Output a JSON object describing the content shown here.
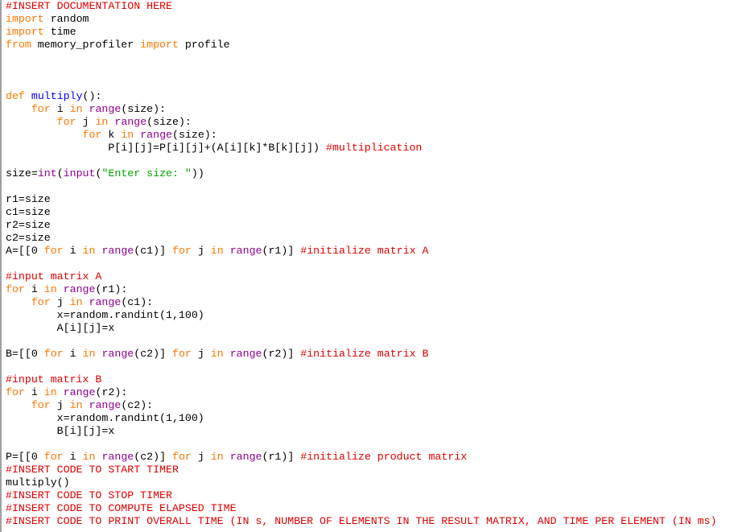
{
  "editor": {
    "colors": {
      "keyword": "#ff7700",
      "builtin": "#900090",
      "comment": "#dd0000",
      "string": "#00aa00",
      "definition": "#0000ff",
      "default": "#000000"
    },
    "lines": [
      [
        {
          "t": "cm",
          "v": "#INSERT DOCUMENTATION HERE"
        }
      ],
      [
        {
          "t": "kw",
          "v": "import"
        },
        {
          "t": "df",
          "v": " random"
        }
      ],
      [
        {
          "t": "kw",
          "v": "import"
        },
        {
          "t": "df",
          "v": " time"
        }
      ],
      [
        {
          "t": "kw",
          "v": "from"
        },
        {
          "t": "df",
          "v": " memory_profiler "
        },
        {
          "t": "kw",
          "v": "import"
        },
        {
          "t": "df",
          "v": " profile"
        }
      ],
      [],
      [],
      [],
      [
        {
          "t": "kw",
          "v": "def"
        },
        {
          "t": "df",
          "v": " "
        },
        {
          "t": "fn",
          "v": "multiply"
        },
        {
          "t": "df",
          "v": "():"
        }
      ],
      [
        {
          "t": "df",
          "v": "    "
        },
        {
          "t": "kw",
          "v": "for"
        },
        {
          "t": "df",
          "v": " i "
        },
        {
          "t": "kw",
          "v": "in"
        },
        {
          "t": "df",
          "v": " "
        },
        {
          "t": "bi",
          "v": "range"
        },
        {
          "t": "df",
          "v": "(size):"
        }
      ],
      [
        {
          "t": "df",
          "v": "        "
        },
        {
          "t": "kw",
          "v": "for"
        },
        {
          "t": "df",
          "v": " j "
        },
        {
          "t": "kw",
          "v": "in"
        },
        {
          "t": "df",
          "v": " "
        },
        {
          "t": "bi",
          "v": "range"
        },
        {
          "t": "df",
          "v": "(size):"
        }
      ],
      [
        {
          "t": "df",
          "v": "            "
        },
        {
          "t": "kw",
          "v": "for"
        },
        {
          "t": "df",
          "v": " k "
        },
        {
          "t": "kw",
          "v": "in"
        },
        {
          "t": "df",
          "v": " "
        },
        {
          "t": "bi",
          "v": "range"
        },
        {
          "t": "df",
          "v": "(size):"
        }
      ],
      [
        {
          "t": "df",
          "v": "                P[i][j]=P[i][j]+(A[i][k]*B[k][j]) "
        },
        {
          "t": "cm",
          "v": "#multiplication"
        }
      ],
      [],
      [
        {
          "t": "df",
          "v": "size="
        },
        {
          "t": "bi",
          "v": "int"
        },
        {
          "t": "df",
          "v": "("
        },
        {
          "t": "bi",
          "v": "input"
        },
        {
          "t": "df",
          "v": "("
        },
        {
          "t": "st",
          "v": "\"Enter size: \""
        },
        {
          "t": "df",
          "v": "))"
        }
      ],
      [],
      [
        {
          "t": "df",
          "v": "r1=size"
        }
      ],
      [
        {
          "t": "df",
          "v": "c1=size"
        }
      ],
      [
        {
          "t": "df",
          "v": "r2=size"
        }
      ],
      [
        {
          "t": "df",
          "v": "c2=size"
        }
      ],
      [
        {
          "t": "df",
          "v": "A=[[0 "
        },
        {
          "t": "kw",
          "v": "for"
        },
        {
          "t": "df",
          "v": " i "
        },
        {
          "t": "kw",
          "v": "in"
        },
        {
          "t": "df",
          "v": " "
        },
        {
          "t": "bi",
          "v": "range"
        },
        {
          "t": "df",
          "v": "(c1)] "
        },
        {
          "t": "kw",
          "v": "for"
        },
        {
          "t": "df",
          "v": " j "
        },
        {
          "t": "kw",
          "v": "in"
        },
        {
          "t": "df",
          "v": " "
        },
        {
          "t": "bi",
          "v": "range"
        },
        {
          "t": "df",
          "v": "(r1)] "
        },
        {
          "t": "cm",
          "v": "#initialize matrix A"
        }
      ],
      [],
      [
        {
          "t": "cm",
          "v": "#input matrix A"
        }
      ],
      [
        {
          "t": "kw",
          "v": "for"
        },
        {
          "t": "df",
          "v": " i "
        },
        {
          "t": "kw",
          "v": "in"
        },
        {
          "t": "df",
          "v": " "
        },
        {
          "t": "bi",
          "v": "range"
        },
        {
          "t": "df",
          "v": "(r1):"
        }
      ],
      [
        {
          "t": "df",
          "v": "    "
        },
        {
          "t": "kw",
          "v": "for"
        },
        {
          "t": "df",
          "v": " j "
        },
        {
          "t": "kw",
          "v": "in"
        },
        {
          "t": "df",
          "v": " "
        },
        {
          "t": "bi",
          "v": "range"
        },
        {
          "t": "df",
          "v": "(c1):"
        }
      ],
      [
        {
          "t": "df",
          "v": "        x=random.randint(1,100)"
        }
      ],
      [
        {
          "t": "df",
          "v": "        A[i][j]=x"
        }
      ],
      [],
      [
        {
          "t": "df",
          "v": "B=[[0 "
        },
        {
          "t": "kw",
          "v": "for"
        },
        {
          "t": "df",
          "v": " i "
        },
        {
          "t": "kw",
          "v": "in"
        },
        {
          "t": "df",
          "v": " "
        },
        {
          "t": "bi",
          "v": "range"
        },
        {
          "t": "df",
          "v": "(c2)] "
        },
        {
          "t": "kw",
          "v": "for"
        },
        {
          "t": "df",
          "v": " j "
        },
        {
          "t": "kw",
          "v": "in"
        },
        {
          "t": "df",
          "v": " "
        },
        {
          "t": "bi",
          "v": "range"
        },
        {
          "t": "df",
          "v": "(r2)] "
        },
        {
          "t": "cm",
          "v": "#initialize matrix B"
        }
      ],
      [],
      [
        {
          "t": "cm",
          "v": "#input matrix B"
        }
      ],
      [
        {
          "t": "kw",
          "v": "for"
        },
        {
          "t": "df",
          "v": " i "
        },
        {
          "t": "kw",
          "v": "in"
        },
        {
          "t": "df",
          "v": " "
        },
        {
          "t": "bi",
          "v": "range"
        },
        {
          "t": "df",
          "v": "(r2):"
        }
      ],
      [
        {
          "t": "df",
          "v": "    "
        },
        {
          "t": "kw",
          "v": "for"
        },
        {
          "t": "df",
          "v": " j "
        },
        {
          "t": "kw",
          "v": "in"
        },
        {
          "t": "df",
          "v": " "
        },
        {
          "t": "bi",
          "v": "range"
        },
        {
          "t": "df",
          "v": "(c2):"
        }
      ],
      [
        {
          "t": "df",
          "v": "        x=random.randint(1,100)"
        }
      ],
      [
        {
          "t": "df",
          "v": "        B[i][j]=x"
        }
      ],
      [],
      [
        {
          "t": "df",
          "v": "P=[[0 "
        },
        {
          "t": "kw",
          "v": "for"
        },
        {
          "t": "df",
          "v": " i "
        },
        {
          "t": "kw",
          "v": "in"
        },
        {
          "t": "df",
          "v": " "
        },
        {
          "t": "bi",
          "v": "range"
        },
        {
          "t": "df",
          "v": "(c2)] "
        },
        {
          "t": "kw",
          "v": "for"
        },
        {
          "t": "df",
          "v": " j "
        },
        {
          "t": "kw",
          "v": "in"
        },
        {
          "t": "df",
          "v": " "
        },
        {
          "t": "bi",
          "v": "range"
        },
        {
          "t": "df",
          "v": "(r1)] "
        },
        {
          "t": "cm",
          "v": "#initialize product matrix"
        }
      ],
      [
        {
          "t": "cm",
          "v": "#INSERT CODE TO START TIMER"
        }
      ],
      [
        {
          "t": "df",
          "v": "multiply()"
        }
      ],
      [
        {
          "t": "cm",
          "v": "#INSERT CODE TO STOP TIMER"
        }
      ],
      [
        {
          "t": "cm",
          "v": "#INSERT CODE TO COMPUTE ELAPSED TIME"
        }
      ],
      [
        {
          "t": "cm",
          "v": "#INSERT CODE TO PRINT OVERALL TIME (IN s, NUMBER OF ELEMENTS IN THE RESULT MATRIX, AND TIME PER ELEMENT (IN ms)"
        }
      ]
    ]
  }
}
